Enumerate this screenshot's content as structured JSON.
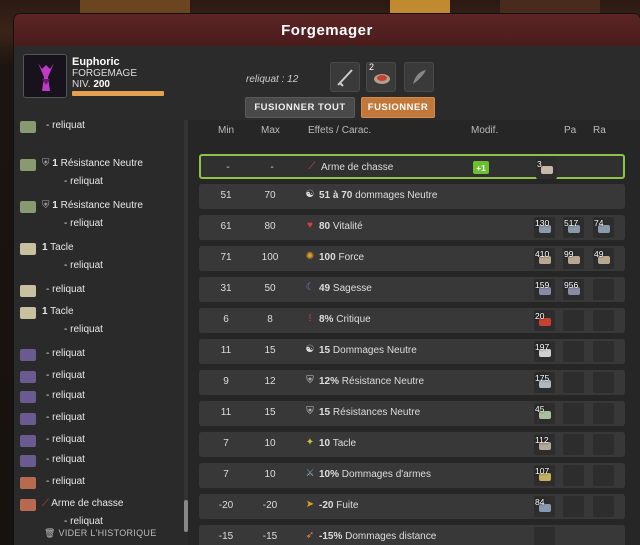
{
  "window": {
    "title": "Forgemager"
  },
  "character": {
    "name": "Euphoric",
    "class": "FORGEMAGE",
    "level_label": "NIV.",
    "level": "200"
  },
  "reliquat": {
    "label": "reliquat : 12"
  },
  "rune_slots": [
    {
      "count": "",
      "icon": "sword-icon"
    },
    {
      "count": "2",
      "icon": "rune-icon"
    },
    {
      "count": "",
      "icon": "feather-icon"
    }
  ],
  "buttons": {
    "fuse_all": "FUSIONNER TOUT",
    "fuse": "FUSIONNER"
  },
  "history": {
    "items": [
      {
        "icon": "resist-rune-icon",
        "text": "- reliquat"
      },
      {
        "icon": "resist-rune-icon",
        "shield": true,
        "bold": "1",
        "label": "Résistance Neutre"
      },
      {
        "text": "- reliquat"
      },
      {
        "icon": "resist-rune-icon",
        "shield": true,
        "bold": "1",
        "label": "Résistance Neutre"
      },
      {
        "text": "- reliquat"
      },
      {
        "icon": "tackle-rune-icon",
        "bold": "1",
        "label": "Tacle"
      },
      {
        "text": "- reliquat"
      },
      {
        "icon": "tackle-rune-icon",
        "text": "- reliquat"
      },
      {
        "icon": "tackle-rune-icon",
        "bold": "1",
        "label": "Tacle"
      },
      {
        "text": "- reliquat"
      },
      {
        "icon": "purple-rune-icon",
        "text": "- reliquat"
      },
      {
        "icon": "purple-rune-icon",
        "text": "- reliquat"
      },
      {
        "icon": "purple-rune-icon",
        "text": "- reliquat"
      },
      {
        "icon": "purple-rune-icon",
        "text": "- reliquat"
      },
      {
        "icon": "purple-rune-icon",
        "text": "- reliquat"
      },
      {
        "icon": "purple-rune-icon",
        "text": "- reliquat"
      },
      {
        "icon": "red-rune-icon",
        "text": "- reliquat"
      },
      {
        "icon": "red-rune-icon",
        "weapon": true,
        "label": "Arme de chasse"
      },
      {
        "text": "- reliquat"
      }
    ],
    "clear_label": "VIDER L'HISTORIQUE"
  },
  "table": {
    "headers": {
      "min": "Min",
      "max": "Max",
      "effects": "Effets / Carac.",
      "modif": "Modif.",
      "pa": "Pa",
      "ra": "Ra"
    },
    "rows": [
      {
        "min": "-",
        "max": "-",
        "icon": "hunting-icon",
        "value": "",
        "label": "Arme de chasse",
        "color": "blue",
        "modif": "+1",
        "runes": [
          {
            "c": "3",
            "g": "#c8b8a8"
          }
        ],
        "selected": true
      },
      {
        "min": "51",
        "max": "70",
        "icon": "neutral-icon",
        "value": "51 à 70",
        "label": "dommages Neutre",
        "color": "white",
        "modif": "",
        "runes": []
      },
      {
        "min": "61",
        "max": "80",
        "icon": "heart-icon",
        "value": "80",
        "label": "Vitalité",
        "color": "green",
        "modif": "",
        "runes": [
          {
            "c": "130",
            "g": "#8a9aa8"
          },
          {
            "c": "517",
            "g": "#8a9aa8"
          },
          {
            "c": "74",
            "g": "#8a9aa8"
          }
        ]
      },
      {
        "min": "71",
        "max": "100",
        "icon": "strength-icon",
        "value": "100",
        "label": "Force",
        "color": "green",
        "modif": "",
        "runes": [
          {
            "c": "410",
            "g": "#b8a890"
          },
          {
            "c": "99",
            "g": "#b8a890"
          },
          {
            "c": "49",
            "g": "#b8a890"
          }
        ]
      },
      {
        "min": "31",
        "max": "50",
        "icon": "wisdom-icon",
        "value": "49",
        "label": "Sagesse",
        "color": "green",
        "modif": "",
        "runes": [
          {
            "c": "159",
            "g": "#8a8aa8"
          },
          {
            "c": "956",
            "g": "#8a8aa8"
          },
          {
            "c": "",
            "g": ""
          }
        ]
      },
      {
        "min": "6",
        "max": "8",
        "icon": "critical-icon",
        "value": "8%",
        "label": "Critique",
        "color": "green",
        "modif": "",
        "runes": [
          {
            "c": "20",
            "g": "#c84030"
          },
          {
            "c": "",
            "g": ""
          },
          {
            "c": "",
            "g": ""
          }
        ]
      },
      {
        "min": "11",
        "max": "15",
        "icon": "neutral-icon",
        "value": "15",
        "label": "Dommages Neutre",
        "color": "green",
        "modif": "",
        "runes": [
          {
            "c": "197",
            "g": "#d0d0d0"
          },
          {
            "c": "",
            "g": ""
          },
          {
            "c": "",
            "g": ""
          }
        ]
      },
      {
        "min": "9",
        "max": "12",
        "icon": "shield-icon",
        "value": "12%",
        "label": "Résistance Neutre",
        "color": "green",
        "modif": "",
        "runes": [
          {
            "c": "175",
            "g": "#b0b8c0"
          },
          {
            "c": "",
            "g": ""
          },
          {
            "c": "",
            "g": ""
          }
        ]
      },
      {
        "min": "11",
        "max": "15",
        "icon": "shield-icon",
        "value": "15",
        "label": "Résistances Neutre",
        "color": "green",
        "modif": "",
        "runes": [
          {
            "c": "45",
            "g": "#a8c0a0"
          },
          {
            "c": "",
            "g": ""
          },
          {
            "c": "",
            "g": ""
          }
        ]
      },
      {
        "min": "7",
        "max": "10",
        "icon": "tackle-icon",
        "value": "10",
        "label": "Tacle",
        "color": "green",
        "modif": "",
        "runes": [
          {
            "c": "112",
            "g": "#b0a898"
          },
          {
            "c": "",
            "g": ""
          },
          {
            "c": "",
            "g": ""
          }
        ]
      },
      {
        "min": "7",
        "max": "10",
        "icon": "weapon-damage-icon",
        "value": "10%",
        "label": "Dommages d'armes",
        "color": "green",
        "modif": "",
        "runes": [
          {
            "c": "107",
            "g": "#c0b060"
          },
          {
            "c": "",
            "g": ""
          },
          {
            "c": "",
            "g": ""
          }
        ]
      },
      {
        "min": "-20",
        "max": "-20",
        "icon": "flee-icon",
        "value": "-20",
        "label": "Fuite",
        "color": "red",
        "modif": "",
        "runes": [
          {
            "c": "84",
            "g": "#8898b0"
          },
          {
            "c": "",
            "g": ""
          },
          {
            "c": "",
            "g": ""
          }
        ]
      },
      {
        "min": "-15",
        "max": "-15",
        "icon": "ranged-icon",
        "value": "-15%",
        "label": "Dommages distance",
        "color": "red",
        "modif": "",
        "runes": [
          {
            "c": "",
            "g": ""
          }
        ]
      }
    ]
  }
}
